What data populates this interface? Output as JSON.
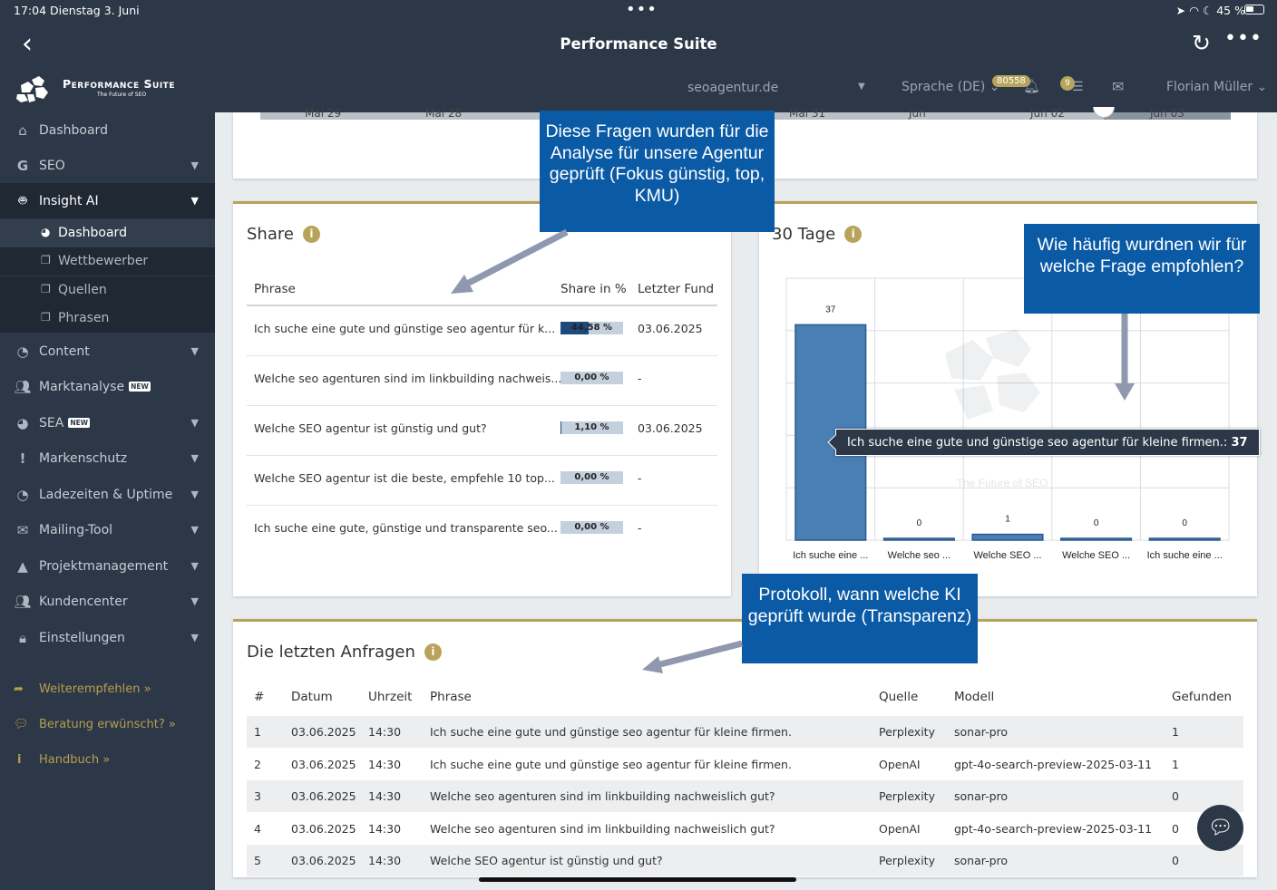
{
  "status_bar": {
    "time_date": "17:04   Dienstag 3. Juni",
    "right": "45 %",
    "dots": "•••"
  },
  "header": {
    "title": "Performance Suite",
    "back_icon": "chevron-left-icon",
    "reload_icon": "reload-icon",
    "more_icon": "ellipsis-icon"
  },
  "brand": {
    "name": "Performance Suite",
    "tagline": "The Future of SEO"
  },
  "topbar": {
    "domain": "seoagentur.de",
    "language": "Sprache (DE)",
    "notifications_count": "80558",
    "tasks_count": "9",
    "user": "Florian Müller"
  },
  "sidebar": {
    "items": [
      {
        "label": "Dashboard",
        "icon": "home-icon"
      },
      {
        "label": "SEO",
        "icon": "google-icon"
      },
      {
        "label": "Insight AI",
        "icon": "robot-icon"
      },
      {
        "label": "Content",
        "icon": "clock-icon"
      },
      {
        "label": "Marktanalyse",
        "icon": "users-icon",
        "badge": "NEW"
      },
      {
        "label": "SEA",
        "icon": "pie-chart-icon",
        "badge": "NEW"
      },
      {
        "label": "Markenschutz",
        "icon": "exclamation-icon"
      },
      {
        "label": "Ladezeiten & Uptime",
        "icon": "clock-icon"
      },
      {
        "label": "Mailing-Tool",
        "icon": "envelope-icon"
      },
      {
        "label": "Projektmanagement",
        "icon": "road-icon"
      },
      {
        "label": "Kundencenter",
        "icon": "users-icon"
      },
      {
        "label": "Einstellungen",
        "icon": "lock-icon"
      }
    ],
    "subitems": [
      {
        "label": "Dashboard",
        "icon": "dashboard-icon"
      },
      {
        "label": "Wettbewerber",
        "icon": "copy-icon"
      },
      {
        "label": "Quellen",
        "icon": "copy-icon"
      },
      {
        "label": "Phrasen",
        "icon": "copy-icon"
      }
    ],
    "links": [
      {
        "label": "Weiterempfehlen »",
        "icon": "share-icon"
      },
      {
        "label": "Beratung erwünscht? »",
        "icon": "comments-icon"
      },
      {
        "label": "Handbuch »",
        "icon": "info-icon"
      }
    ]
  },
  "timeline": {
    "ticks": [
      "Mai 29",
      "Mai 28",
      "Mai 31",
      "Jun",
      "Jun 02",
      "Jun 03"
    ]
  },
  "share": {
    "title": "Share",
    "columns": [
      "Phrase",
      "Share in %",
      "Letzter Fund"
    ],
    "rows": [
      {
        "phrase": "Ich suche eine gute und günstige seo agentur für k...",
        "share": "44,58 %",
        "share_value": 44.58,
        "last": "03.06.2025"
      },
      {
        "phrase": "Welche seo agenturen sind im linkbuilding nachweis...",
        "share": "0,00 %",
        "share_value": 0,
        "last": "-"
      },
      {
        "phrase": "Welche SEO agentur ist günstig und gut?",
        "share": "1,10 %",
        "share_value": 1.1,
        "last": "03.06.2025"
      },
      {
        "phrase": "Welche SEO agentur ist die beste, empfehle 10 top...",
        "share": "0,00 %",
        "share_value": 0,
        "last": "-"
      },
      {
        "phrase": "Ich suche eine gute, günstige und transparente seo...",
        "share": "0,00 %",
        "share_value": 0,
        "last": "-"
      }
    ]
  },
  "chart_panel": {
    "title": "30 Tage",
    "watermark": "The Future of SEO"
  },
  "chart_data": {
    "type": "bar",
    "categories": [
      "Ich suche eine ...",
      "Welche seo ...",
      "Welche SEO ...",
      "Welche SEO ...",
      "Ich suche eine ..."
    ],
    "values": [
      37,
      0,
      1,
      0,
      0
    ],
    "value_labels": [
      "37",
      "0",
      "1",
      "0",
      "0"
    ],
    "ylim": [
      0,
      45
    ],
    "grid": true,
    "tooltip": {
      "label": "Ich suche eine gute und günstige seo agentur für kleine firmen.:",
      "value": "37"
    },
    "colors": {
      "bar": "#4a7fb4",
      "bar_border": "#2a5a8f"
    }
  },
  "requests": {
    "title": "Die letzten Anfragen",
    "columns": [
      "#",
      "Datum",
      "Uhrzeit",
      "Phrase",
      "Quelle",
      "Modell",
      "Gefunden"
    ],
    "rows": [
      {
        "n": "1",
        "date": "03.06.2025",
        "time": "14:30",
        "phrase": "Ich suche eine gute und günstige seo agentur für kleine firmen.",
        "source": "Perplexity",
        "model": "sonar-pro",
        "found": "1"
      },
      {
        "n": "2",
        "date": "03.06.2025",
        "time": "14:30",
        "phrase": "Ich suche eine gute und günstige seo agentur für kleine firmen.",
        "source": "OpenAI",
        "model": "gpt-4o-search-preview-2025-03-11",
        "found": "1"
      },
      {
        "n": "3",
        "date": "03.06.2025",
        "time": "14:30",
        "phrase": "Welche seo agenturen sind im linkbuilding nachweislich gut?",
        "source": "Perplexity",
        "model": "sonar-pro",
        "found": "0"
      },
      {
        "n": "4",
        "date": "03.06.2025",
        "time": "14:30",
        "phrase": "Welche seo agenturen sind im linkbuilding nachweislich gut?",
        "source": "OpenAI",
        "model": "gpt-4o-search-preview-2025-03-11",
        "found": "0"
      },
      {
        "n": "5",
        "date": "03.06.2025",
        "time": "14:30",
        "phrase": "Welche SEO agentur ist günstig und gut?",
        "source": "Perplexity",
        "model": "sonar-pro",
        "found": "0"
      }
    ]
  },
  "callouts": [
    {
      "text": "Diese Fragen wurden für die Analyse für unsere Agentur geprüft (Fokus günstig, top, KMU)"
    },
    {
      "text": "Wie häufig wurdnen wir für welche Frage empfohlen?"
    },
    {
      "text": "Protokoll, wann welche KI geprüft wurde (Transparenz)"
    }
  ],
  "colors": {
    "header": "#2c3847",
    "accent_gold": "#b8a35a",
    "callout_blue": "#0a5aa6",
    "bar_dark": "#1d4a7a"
  }
}
